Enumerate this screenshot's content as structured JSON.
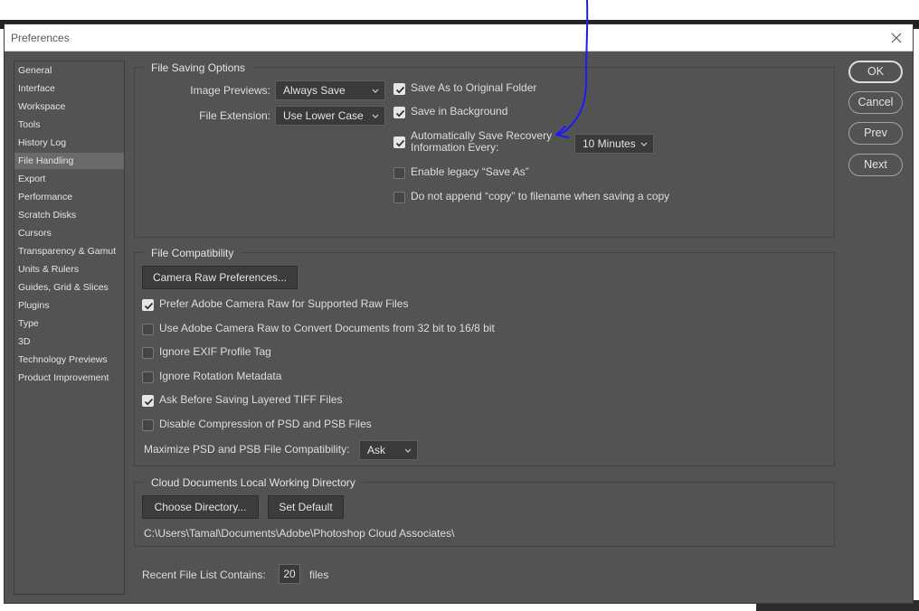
{
  "dialog": {
    "title": "Preferences"
  },
  "sidebar": {
    "items": [
      {
        "label": "General"
      },
      {
        "label": "Interface"
      },
      {
        "label": "Workspace"
      },
      {
        "label": "Tools"
      },
      {
        "label": "History Log"
      },
      {
        "label": "File Handling",
        "selected": true
      },
      {
        "label": "Export"
      },
      {
        "label": "Performance"
      },
      {
        "label": "Scratch Disks"
      },
      {
        "label": "Cursors"
      },
      {
        "label": "Transparency & Gamut"
      },
      {
        "label": "Units & Rulers"
      },
      {
        "label": "Guides, Grid & Slices"
      },
      {
        "label": "Plugins"
      },
      {
        "label": "Type"
      },
      {
        "label": "3D"
      },
      {
        "label": "Technology Previews"
      },
      {
        "label": "Product Improvement"
      }
    ]
  },
  "file_saving": {
    "legend": "File Saving Options",
    "image_previews_label": "Image Previews:",
    "image_previews_value": "Always Save",
    "file_extension_label": "File Extension:",
    "file_extension_value": "Use Lower Case",
    "save_as_original_folder": {
      "label": "Save As to Original Folder",
      "checked": true
    },
    "save_in_background": {
      "label": "Save in Background",
      "checked": true
    },
    "auto_save_recovery": {
      "label_line1": "Automatically Save Recovery",
      "label_line2": "Information Every:",
      "checked": true
    },
    "auto_save_interval": "10 Minutes",
    "enable_legacy_save_as": {
      "label": "Enable legacy “Save As”",
      "checked": false
    },
    "no_copy_append": {
      "label": "Do not append “copy” to filename when saving a copy",
      "checked": false
    }
  },
  "file_compat": {
    "legend": "File Compatibility",
    "camera_raw_prefs_button": "Camera Raw Preferences...",
    "options": [
      {
        "label": "Prefer Adobe Camera Raw for Supported Raw Files",
        "checked": true
      },
      {
        "label": "Use Adobe Camera Raw to Convert Documents from 32 bit to 16/8 bit",
        "checked": false
      },
      {
        "label": "Ignore EXIF Profile Tag",
        "checked": false
      },
      {
        "label": "Ignore Rotation Metadata",
        "checked": false
      },
      {
        "label": "Ask Before Saving Layered TIFF Files",
        "checked": true
      },
      {
        "label": "Disable Compression of PSD and PSB Files",
        "checked": false
      }
    ],
    "maximize_label": "Maximize PSD and PSB File Compatibility:",
    "maximize_value": "Ask"
  },
  "cloud_docs": {
    "legend": "Cloud Documents Local Working Directory",
    "choose_button": "Choose Directory...",
    "default_button": "Set Default",
    "path": "C:\\Users\\Tamal\\Documents\\Adobe\\Photoshop Cloud Associates\\"
  },
  "recent_files": {
    "label": "Recent File List Contains:",
    "value": "20",
    "suffix": "files"
  },
  "actions": {
    "ok": "OK",
    "cancel": "Cancel",
    "prev": "Prev",
    "next": "Next"
  },
  "colors": {
    "dialog_bg": "#535353",
    "annotation": "#1a1aff"
  }
}
